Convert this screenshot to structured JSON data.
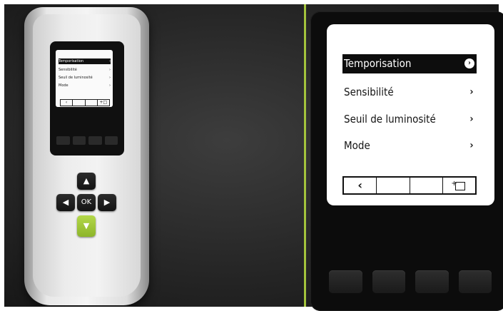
{
  "remote": {
    "mini_menu": [
      {
        "label": "Temporisation",
        "chevron": "›",
        "selected": true
      },
      {
        "label": "Sensibilité",
        "chevron": "›",
        "selected": false
      },
      {
        "label": "Seuil de luminosité",
        "chevron": "›",
        "selected": false
      },
      {
        "label": "Mode",
        "chevron": "›",
        "selected": false
      }
    ],
    "mini_softbar": [
      "‹",
      "",
      "",
      "+□"
    ],
    "dpad": {
      "up": "▲",
      "left": "◀",
      "ok": "OK",
      "right": "▶",
      "down": "▼"
    }
  },
  "device": {
    "menu": [
      {
        "label": "Temporisation",
        "chevron": "›",
        "selected": true
      },
      {
        "label": "Sensibilité",
        "chevron": "›",
        "selected": false
      },
      {
        "label": "Seuil de luminosité",
        "chevron": "›",
        "selected": false
      },
      {
        "label": "Mode",
        "chevron": "›",
        "selected": false
      }
    ],
    "softbar": {
      "back": "‹",
      "slot2": "",
      "slot3": "",
      "add_plus": "+"
    }
  },
  "colors": {
    "accent": "#a4c43c",
    "down_key": "#a4c93b",
    "background": "#2b2b2b",
    "selected_row": "#0d0d0d"
  }
}
